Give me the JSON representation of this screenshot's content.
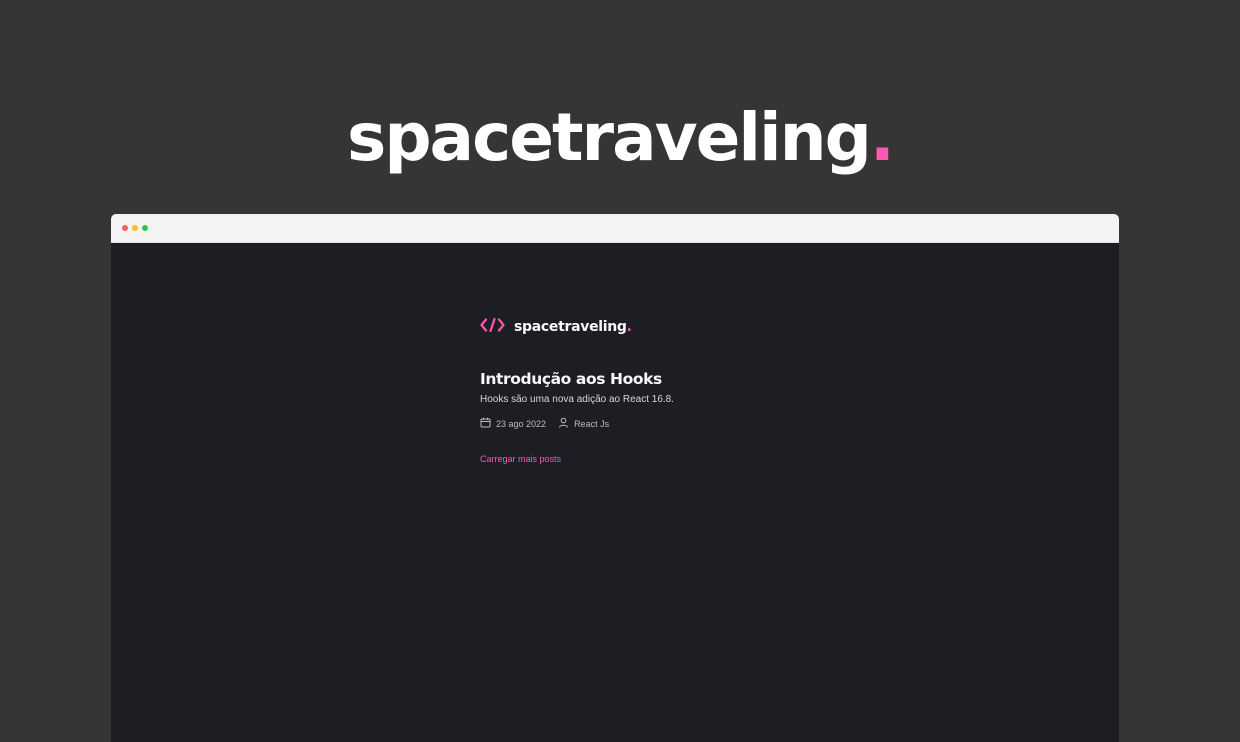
{
  "hero": {
    "brand": "spacetraveling",
    "dot": "."
  },
  "browser": {
    "traffic_lights": [
      "#ff5f57",
      "#febc2e",
      "#28c840"
    ]
  },
  "app": {
    "logo": {
      "icon": "code-brackets-icon",
      "text": "spacetraveling",
      "dot": "."
    },
    "posts": [
      {
        "title": "Introdução aos Hooks",
        "subtitle": "Hooks são uma nova adição ao React 16.8.",
        "date": "23 ago 2022",
        "author": "React Js"
      }
    ],
    "load_more_label": "Carregar mais posts"
  },
  "colors": {
    "accent": "#ff57b2",
    "background": "#353535",
    "app_bg": "#1c1e24"
  }
}
